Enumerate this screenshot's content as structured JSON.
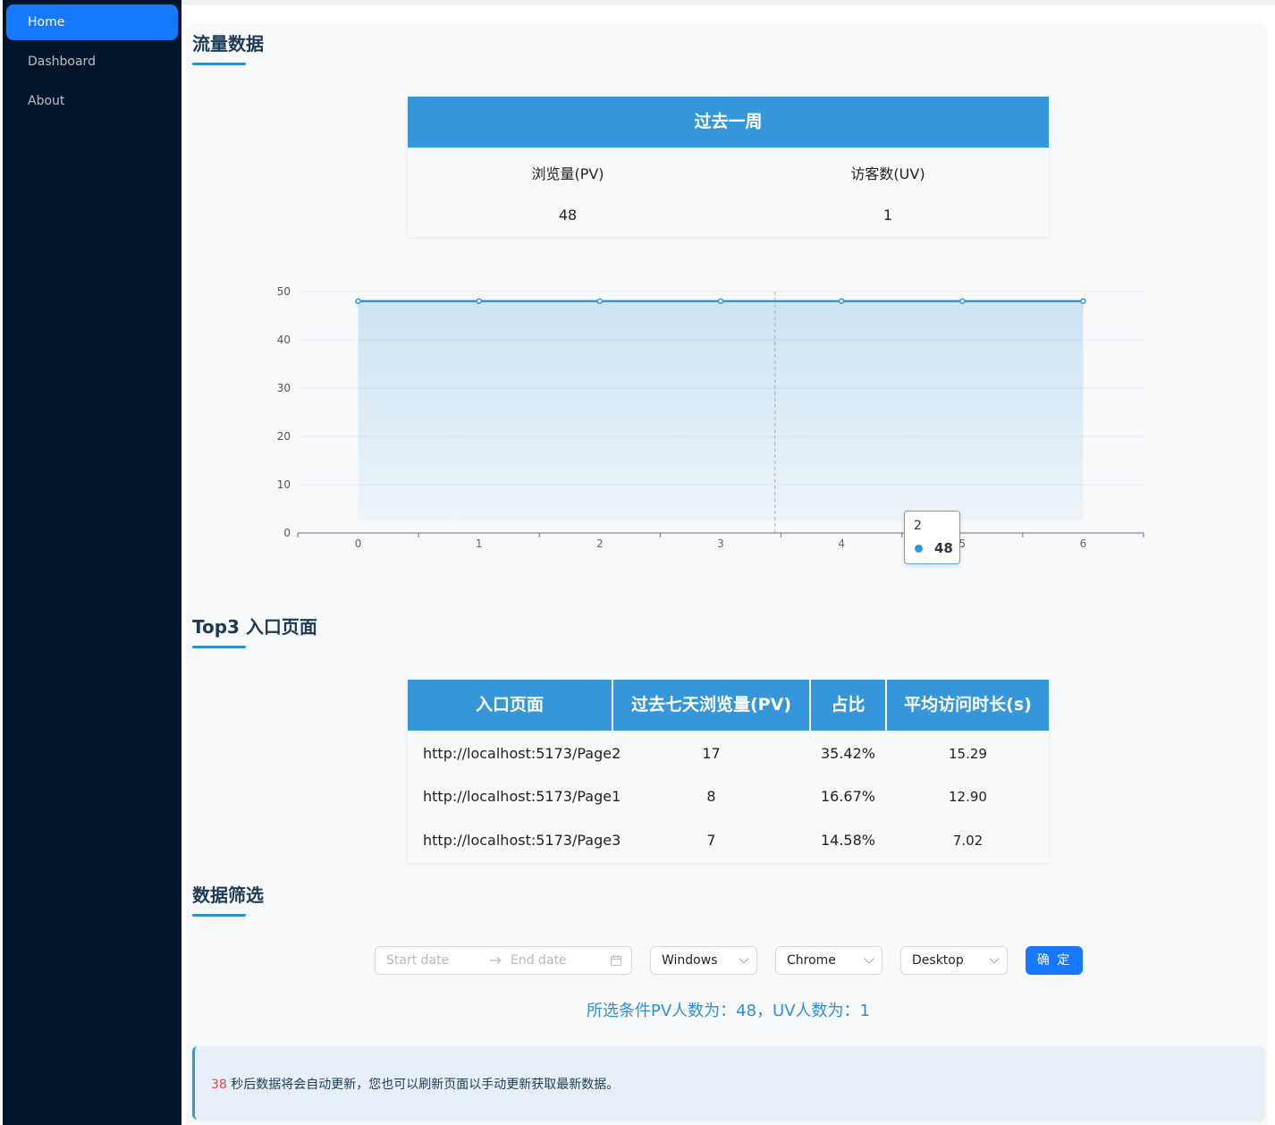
{
  "sidebar": {
    "items": [
      {
        "label": "Home",
        "active": true
      },
      {
        "label": "Dashboard",
        "active": false
      },
      {
        "label": "About",
        "active": false
      }
    ]
  },
  "traffic": {
    "title": "流量数据",
    "period_header": "过去一周",
    "pv_label": "浏览量(PV)",
    "uv_label": "访客数(UV)",
    "pv_value": "48",
    "uv_value": "1"
  },
  "chart_data": {
    "type": "area",
    "x": [
      0,
      1,
      2,
      3,
      4,
      5,
      6
    ],
    "series": [
      {
        "values": [
          48,
          48,
          48,
          48,
          48,
          48,
          48
        ]
      }
    ],
    "xlim": [
      -0.5,
      6.5
    ],
    "ylim": [
      0,
      50
    ],
    "yticks": [
      0,
      10,
      20,
      30,
      40,
      50
    ],
    "grid": true,
    "color": "#3597d9",
    "tooltip": {
      "x": "2",
      "value": "48"
    }
  },
  "top3": {
    "title": "Top3 入口页面",
    "headers": [
      "入口页面",
      "过去七天浏览量(PV)",
      "占比",
      "平均访问时长(s)"
    ],
    "rows": [
      [
        "http://localhost:5173/Page2",
        "17",
        "35.42%",
        "15.29"
      ],
      [
        "http://localhost:5173/Page1",
        "8",
        "16.67%",
        "12.90"
      ],
      [
        "http://localhost:5173/Page3",
        "7",
        "14.58%",
        "7.02"
      ]
    ]
  },
  "filter": {
    "title": "数据筛选",
    "start_placeholder": "Start date",
    "end_placeholder": "End date",
    "os": "Windows",
    "browser": "Chrome",
    "device": "Desktop",
    "confirm_label": "确 定",
    "result": "所选条件PV人数为：48，UV人数为：1"
  },
  "notice": {
    "countdown": "38",
    "text": " 秒后数据将会自动更新，您也可以刷新页面以手动更新获取最新数据。"
  },
  "colors": {
    "accent": "#3597d9",
    "primary": "#1677ff",
    "sidebar": "#001529",
    "countdown": "#e54545"
  }
}
